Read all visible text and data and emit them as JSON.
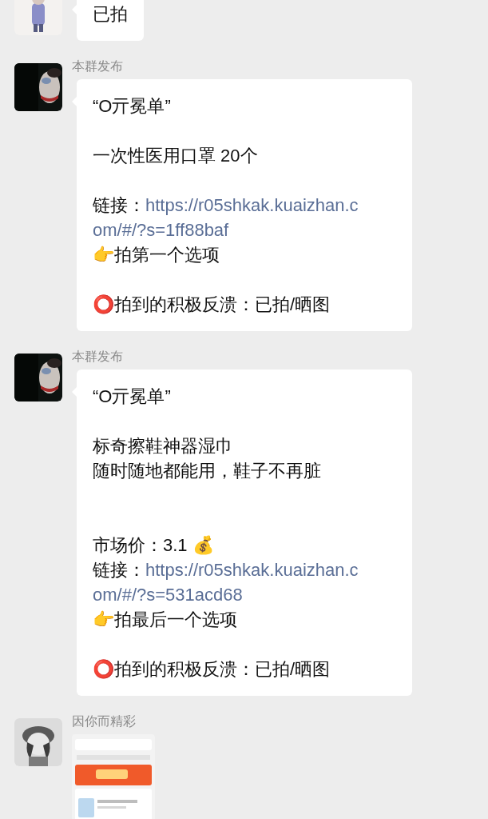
{
  "messages": [
    {
      "kind": "text",
      "lines": [
        {
          "kind": "text",
          "text": "已拍"
        }
      ]
    },
    {
      "kind": "text",
      "name": "本群发布",
      "lines": [
        {
          "kind": "text",
          "text": "“O亓冕单”"
        },
        {
          "kind": "blank"
        },
        {
          "kind": "text",
          "text": "一次性医用口罩 20个"
        },
        {
          "kind": "blank"
        },
        {
          "kind": "link",
          "label": "链接：",
          "link": "https://r05shkak.kuaizhan.c"
        },
        {
          "kind": "link",
          "link": "om/#/?s=1ff88baf"
        },
        {
          "kind": "text",
          "text": "👉拍第一个选项"
        },
        {
          "kind": "blank"
        },
        {
          "kind": "text",
          "text": "⭕拍到的积极反溃：已拍/晒图"
        }
      ]
    },
    {
      "kind": "text",
      "name": "本群发布",
      "lines": [
        {
          "kind": "text",
          "text": "“O亓冕单”"
        },
        {
          "kind": "blank"
        },
        {
          "kind": "text",
          "text": "标奇擦鞋神器湿巾"
        },
        {
          "kind": "text",
          "text": "随时随地都能用，鞋子不再脏"
        },
        {
          "kind": "blank"
        },
        {
          "kind": "blank"
        },
        {
          "kind": "text",
          "text": "市场价：3.1 💰"
        },
        {
          "kind": "link",
          "label": "链接：",
          "link": "https://r05shkak.kuaizhan.c"
        },
        {
          "kind": "link",
          "link": "om/#/?s=531acd68"
        },
        {
          "kind": "text",
          "text": "👉拍最后一个选项"
        },
        {
          "kind": "blank"
        },
        {
          "kind": "text",
          "text": "⭕拍到的积极反溃：已拍/晒图"
        }
      ]
    },
    {
      "name": "因你而精彩"
    }
  ]
}
